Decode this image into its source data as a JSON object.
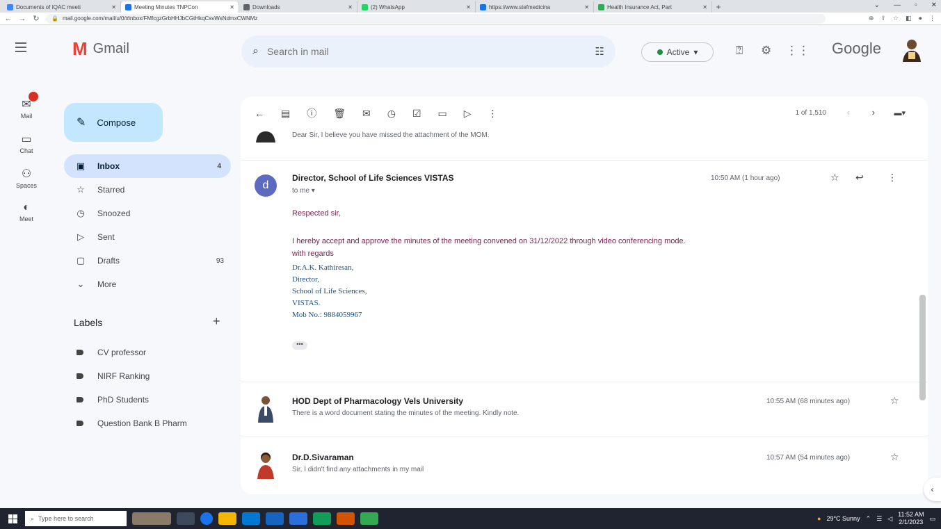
{
  "browser": {
    "tabs": [
      {
        "title": "Documents of IQAC meeti",
        "color": "#4285f4",
        "active": false
      },
      {
        "title": "Meeting Minutes TNPCon",
        "color": "#1a73e8",
        "active": true
      },
      {
        "title": "Downloads",
        "color": "#5f6368",
        "active": false
      },
      {
        "title": "(2) WhatsApp",
        "color": "#25d366",
        "active": false
      },
      {
        "title": "https://www.stefmedicina",
        "color": "#1a73e8",
        "active": false
      },
      {
        "title": "Health Insurance Act, Part",
        "color": "#34a853",
        "active": false
      }
    ],
    "new_tab": "+",
    "url": "mail.google.com/mail/u/0/#inbox/FMfcgzGrbHHJbCGtHkqCsvWsNdmxCWNMz"
  },
  "header": {
    "app_name": "Gmail",
    "search_placeholder": "Search in mail",
    "status": "Active",
    "brand": "Google"
  },
  "rail": [
    {
      "icon": "mail-icon",
      "label": "Mail",
      "glyph": "✉"
    },
    {
      "icon": "chat-icon",
      "label": "Chat",
      "glyph": "▭"
    },
    {
      "icon": "spaces-icon",
      "label": "Spaces",
      "glyph": "⚇"
    },
    {
      "icon": "meet-icon",
      "label": "Meet",
      "glyph": "◐"
    }
  ],
  "sidebar": {
    "compose": "Compose",
    "items": [
      {
        "label": "Inbox",
        "glyph": "▣",
        "count": "4",
        "selected": true
      },
      {
        "label": "Starred",
        "glyph": "☆",
        "count": ""
      },
      {
        "label": "Snoozed",
        "glyph": "◷",
        "count": ""
      },
      {
        "label": "Sent",
        "glyph": "▷",
        "count": ""
      },
      {
        "label": "Drafts",
        "glyph": "▢",
        "count": "93"
      },
      {
        "label": "More",
        "glyph": "⌄",
        "count": ""
      }
    ],
    "labels_title": "Labels",
    "labels": [
      "CV professor",
      "NIRF Ranking",
      "PhD Students",
      "Question Bank B Pharm"
    ]
  },
  "toolbar": {
    "pager": "1 of 1,510"
  },
  "messages": {
    "top_snippet": "Dear Sir, I believe you have missed the attachment of the MOM.",
    "open": {
      "avatar_letter": "d",
      "sender": "Director, School of Life Sciences VISTAS",
      "to": "to me ▾",
      "time": "10:50 AM (1 hour ago)",
      "greeting": "Respected sir,",
      "body": "I hereby accept and approve the minutes of the meeting convened on 31/12/2022 through video conferencing mode.",
      "regards": "with regards",
      "signature": [
        "Dr.A.K. Kathiresan,",
        "Director,",
        "School of Life Sciences,",
        "VISTAS.",
        "Mob No.: 9884059967"
      ],
      "ellipsis": "•••"
    },
    "list": [
      {
        "sender": "HOD Dept of Pharmacology Vels University",
        "snippet": "There is a word document stating the minutes of the meeting. Kindly note.",
        "time": "10:55 AM (68 minutes ago)"
      },
      {
        "sender": "Dr.D.Sivaraman",
        "snippet": "Sir, I didn't find any attachments in my mail",
        "time": "10:57 AM (54 minutes ago)"
      }
    ]
  },
  "taskbar": {
    "search": "Type here to search",
    "weather": "29°C Sunny",
    "time": "11:52 AM",
    "date": "2/1/2023"
  },
  "colors": {
    "accent": "#c2e7ff",
    "selected": "#d3e3fd",
    "body_text": "#7b1f4f",
    "signature": "#1a4f8b"
  }
}
